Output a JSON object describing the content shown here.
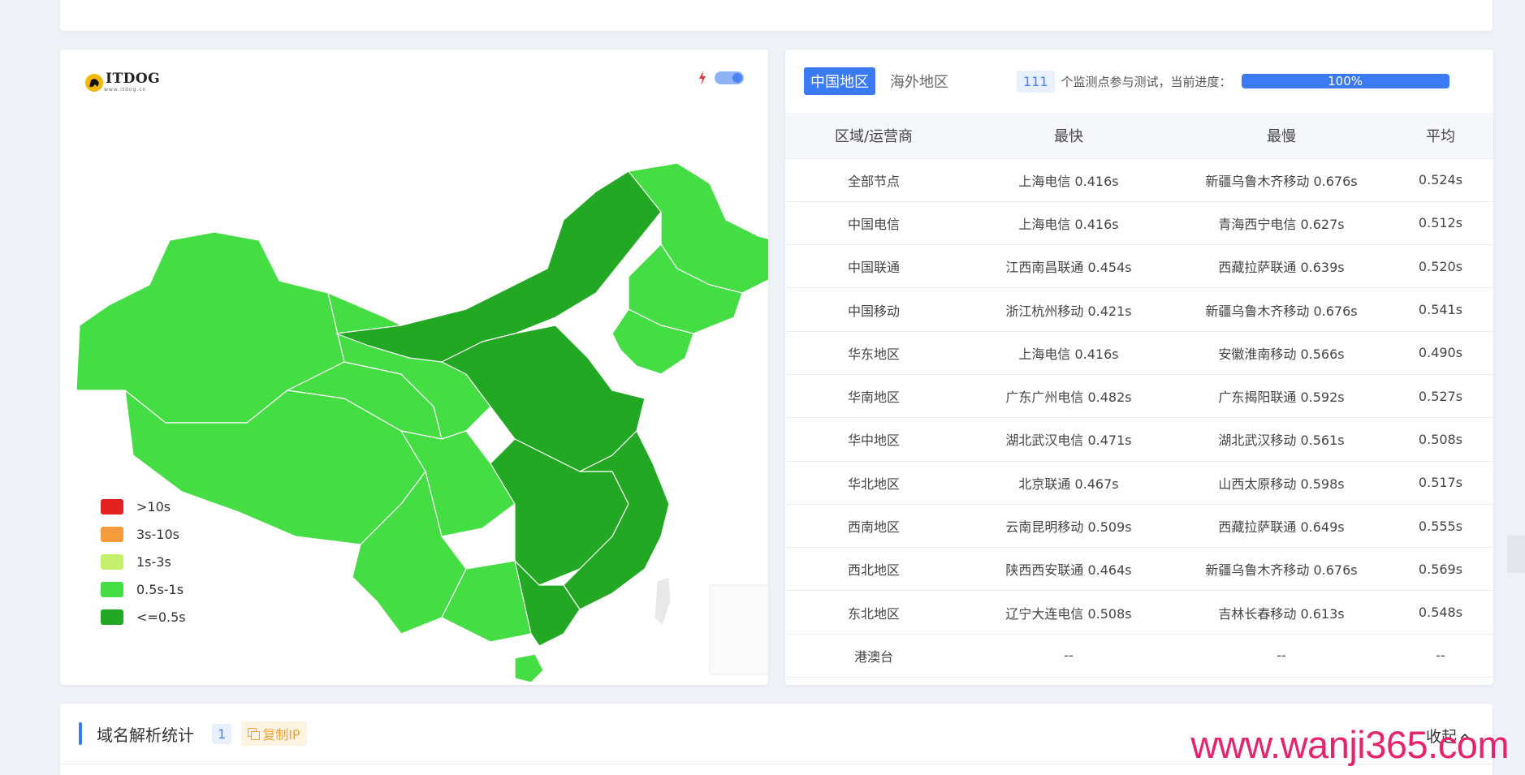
{
  "map": {
    "logo_text": "ITDOG",
    "logo_sub": "www.itdog.cn",
    "legend": [
      {
        "label": ">10s",
        "color": "#e52222"
      },
      {
        "label": "3s-10s",
        "color": "#f59b3b"
      },
      {
        "label": "1s-3s",
        "color": "#c5f06b"
      },
      {
        "label": "0.5s-1s",
        "color": "#44dd44"
      },
      {
        "label": "<=0.5s",
        "color": "#22a822"
      }
    ]
  },
  "stats": {
    "tab_china": "中国地区",
    "tab_overseas": "海外地区",
    "node_count": "111",
    "progress_label": "个监测点参与测试，当前进度：",
    "progress_value": "100%",
    "columns": [
      "区域/运营商",
      "最快",
      "最慢",
      "平均"
    ],
    "rows": [
      [
        "全部节点",
        "上海电信 0.416s",
        "新疆乌鲁木齐移动 0.676s",
        "0.524s"
      ],
      [
        "中国电信",
        "上海电信 0.416s",
        "青海西宁电信 0.627s",
        "0.512s"
      ],
      [
        "中国联通",
        "江西南昌联通 0.454s",
        "西藏拉萨联通 0.639s",
        "0.520s"
      ],
      [
        "中国移动",
        "浙江杭州移动 0.421s",
        "新疆乌鲁木齐移动 0.676s",
        "0.541s"
      ],
      [
        "华东地区",
        "上海电信 0.416s",
        "安徽淮南移动 0.566s",
        "0.490s"
      ],
      [
        "华南地区",
        "广东广州电信 0.482s",
        "广东揭阳联通 0.592s",
        "0.527s"
      ],
      [
        "华中地区",
        "湖北武汉电信 0.471s",
        "湖北武汉移动 0.561s",
        "0.508s"
      ],
      [
        "华北地区",
        "北京联通 0.467s",
        "山西太原移动 0.598s",
        "0.517s"
      ],
      [
        "西南地区",
        "云南昆明移动 0.509s",
        "西藏拉萨联通 0.649s",
        "0.555s"
      ],
      [
        "西北地区",
        "陕西西安联通 0.464s",
        "新疆乌鲁木齐移动 0.676s",
        "0.569s"
      ],
      [
        "东北地区",
        "辽宁大连电信 0.508s",
        "吉林长春移动 0.613s",
        "0.548s"
      ],
      [
        "港澳台",
        "--",
        "--",
        "--"
      ]
    ]
  },
  "bottom": {
    "title": "域名解析统计",
    "badge": "1",
    "copy_label": "复制IP",
    "collapse_label": "收起"
  },
  "watermark": "www.wanji365.com",
  "colors": {
    "accent": "#3a7bf5",
    "dark_green": "#22a822",
    "light_green": "#44dd44"
  }
}
